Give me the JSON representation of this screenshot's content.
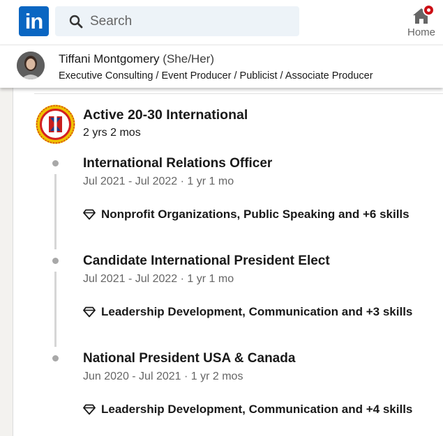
{
  "nav": {
    "logo_text": "in",
    "search_placeholder": "Search",
    "home_label": "Home",
    "brand_color": "#0a66c2",
    "icons": [
      "search-icon",
      "home-icon",
      "notification-badge-icon"
    ]
  },
  "profile": {
    "name": "Tiffani Montgomery",
    "pronouns": "(She/Her)",
    "headline": "Executive Consulting / Event Producer / Publicist / Associate Producer"
  },
  "experience": {
    "organization": "Active 20-30 International",
    "duration": "2 yrs 2 mos",
    "roles": [
      {
        "title": "International Relations Officer",
        "dates": "Jul 2021 - Jul 2022 · 1 yr 1 mo",
        "skills": "Nonprofit Organizations, Public Speaking and +6 skills"
      },
      {
        "title": "Candidate International President Elect",
        "dates": "Jul 2021 - Jul 2022 · 1 yr 1 mo",
        "skills": "Leadership Development, Communication and +3 skills"
      },
      {
        "title": "National President USA & Canada",
        "dates": "Jun 2020 - Jul 2021 · 1 yr 2 mos",
        "skills": "Leadership Development, Communication and +4 skills"
      }
    ]
  }
}
